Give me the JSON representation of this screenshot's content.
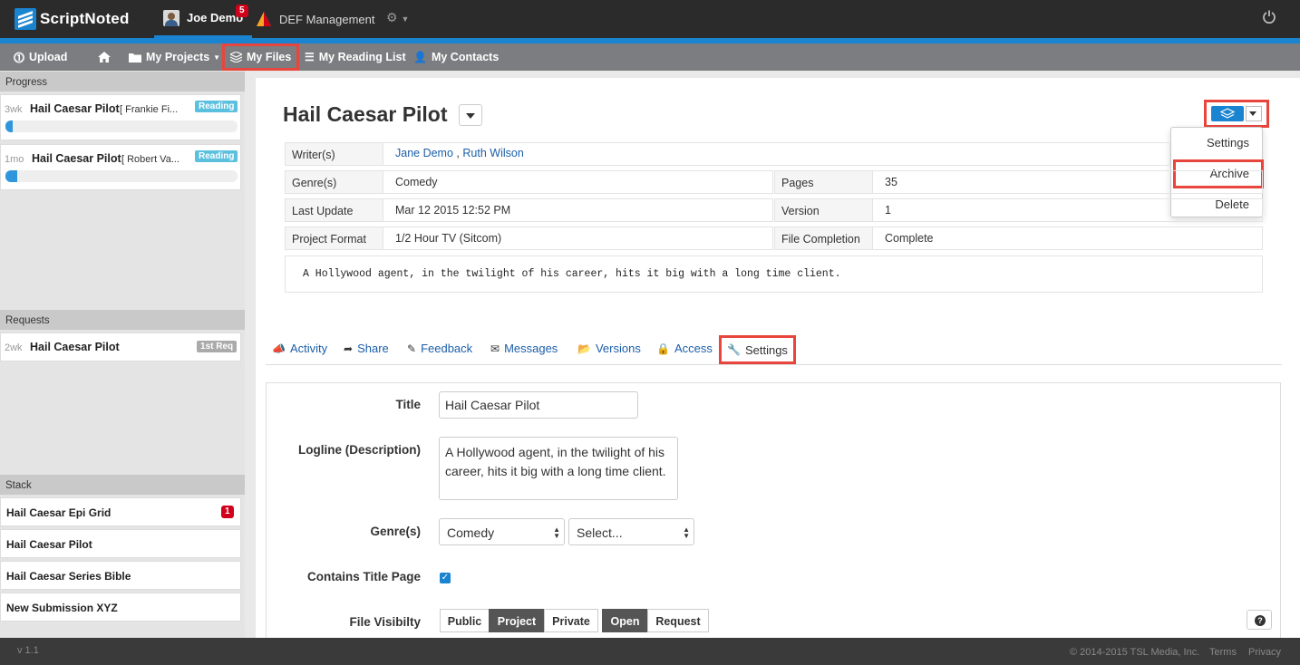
{
  "app": {
    "name": "ScriptNoted",
    "version": "v 1.1"
  },
  "topbar": {
    "user_name": "Joe Demo",
    "notification_count": "5",
    "org_name": "DEF Management"
  },
  "nav": {
    "upload": "Upload",
    "my_projects": "My Projects",
    "my_files": "My Files",
    "reading_list": "My Reading List",
    "contacts": "My Contacts"
  },
  "sidebar": {
    "progress_title": "Progress",
    "progress_items": [
      {
        "age": "3wk",
        "title": "Hail Caesar Pilot",
        "reader": "[ Frankie Fi...",
        "status": "Reading",
        "progress": 0.03
      },
      {
        "age": "1mo",
        "title": "Hail Caesar Pilot",
        "reader": "[ Robert Va...",
        "status": "Reading",
        "progress": 0.05
      }
    ],
    "requests_title": "Requests",
    "request_items": [
      {
        "age": "2wk",
        "title": "Hail Caesar Pilot",
        "tag": "1st Req"
      }
    ],
    "stack_title": "Stack",
    "stack_items": [
      {
        "title": "Hail Caesar Epi Grid",
        "badge": "1"
      },
      {
        "title": "Hail Caesar Pilot"
      },
      {
        "title": "Hail Caesar Series Bible"
      },
      {
        "title": "New Submission XYZ"
      }
    ]
  },
  "project": {
    "title": "Hail Caesar Pilot",
    "writers_label": "Writer(s)",
    "writers": [
      "Jane Demo",
      "Ruth Wilson"
    ],
    "writers_sep": ",",
    "genre_label": "Genre(s)",
    "genre": "Comedy",
    "pages_label": "Pages",
    "pages": "35",
    "last_update_label": "Last Update",
    "last_update": "Mar 12 2015 12:52 PM",
    "version_label": "Version",
    "version": "1",
    "format_label": "Project Format",
    "format": "1/2 Hour TV (Sitcom)",
    "completion_label": "File Completion",
    "completion": "Complete",
    "logline": "A Hollywood agent, in the twilight of his career, hits it big with a long time client."
  },
  "action_menu": {
    "items": [
      "Settings",
      "Archive",
      "Delete"
    ]
  },
  "tabs": [
    "Activity",
    "Share",
    "Feedback",
    "Messages",
    "Versions",
    "Access",
    "Settings"
  ],
  "settings_form": {
    "title_label": "Title",
    "title_value": "Hail Caesar Pilot",
    "logline_label": "Logline (Description)",
    "logline_value": "A Hollywood agent, in the twilight of his career, hits it big with a long time client.",
    "genre_label": "Genre(s)",
    "genre1": "Comedy",
    "genre2": "Select...",
    "title_page_label": "Contains Title Page",
    "title_page_checked": true,
    "visibility_label": "File Visibilty",
    "visibility_options": [
      "Public",
      "Project",
      "Private"
    ],
    "visibility_selected": "Project",
    "access_options": [
      "Open",
      "Request"
    ],
    "access_selected": "Open"
  },
  "footer": {
    "copyright": "© 2014-2015 TSL Media, Inc.",
    "terms": "Terms",
    "privacy": "Privacy"
  },
  "colors": {
    "accent": "#1a84d0",
    "highlight": "#e8453c",
    "topbar": "#2b2b2b",
    "navbar": "#7c7d80"
  }
}
